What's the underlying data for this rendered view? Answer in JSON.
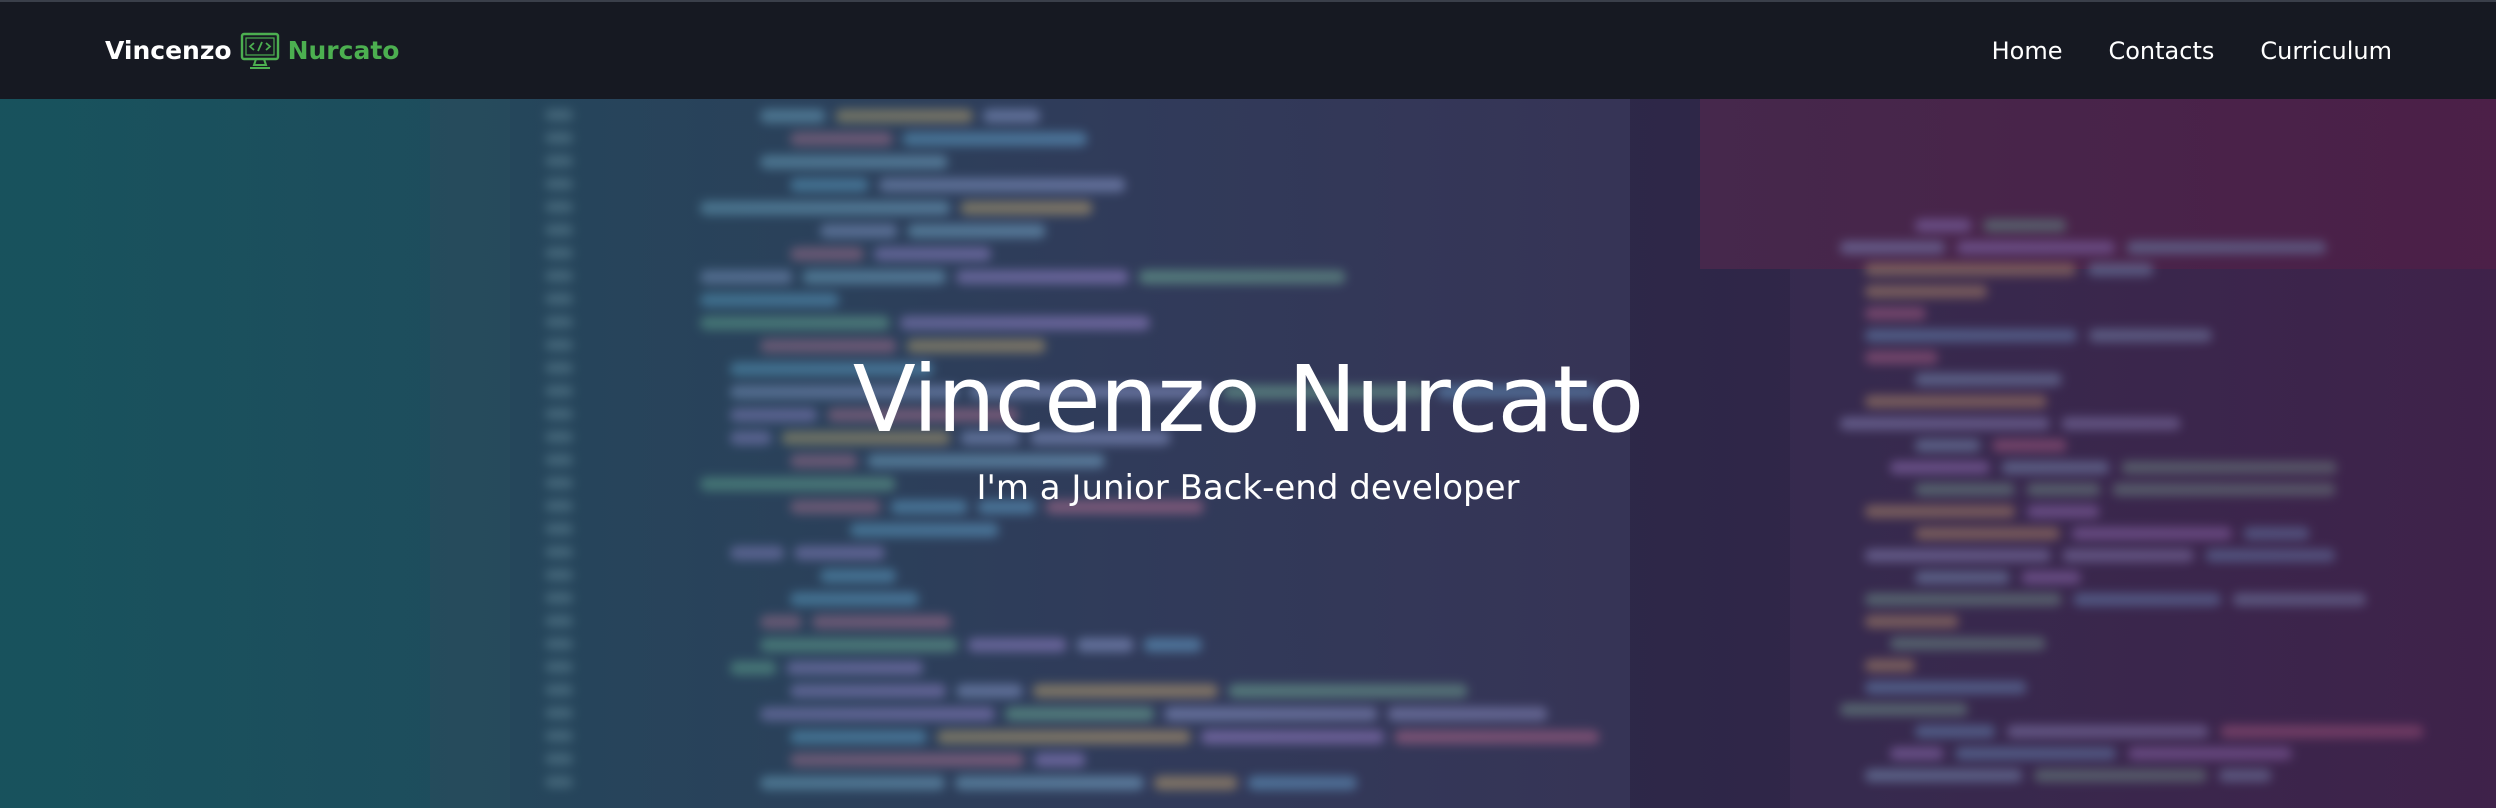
{
  "navbar": {
    "brand_first": "Vincenzo",
    "brand_last": "Nurcato",
    "brand_icon": "code-monitor-icon",
    "links": [
      "Home",
      "Contacts",
      "Curriculum"
    ]
  },
  "hero": {
    "title": "Vincenzo Nurcato",
    "subtitle": "I'm a Junior Back-end developer",
    "background": "blurred-code-editor-image"
  },
  "colors": {
    "navbar_bg": "#161922",
    "brand_accent": "#4caf50",
    "text": "#ffffff"
  }
}
